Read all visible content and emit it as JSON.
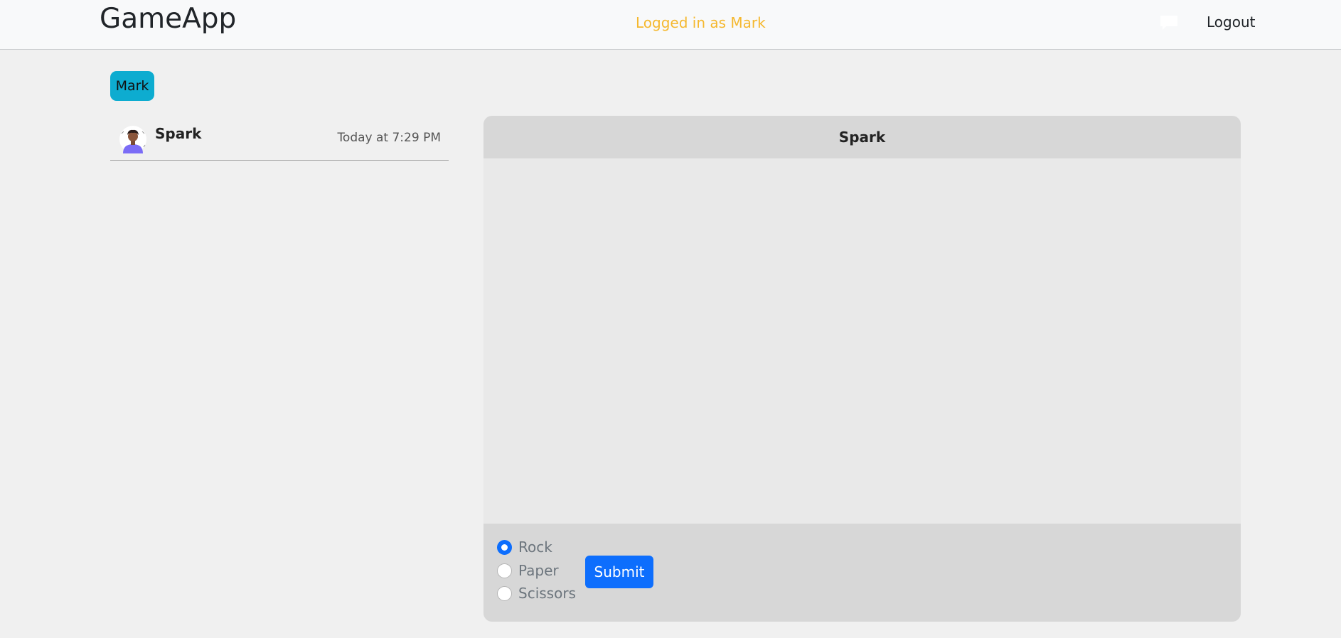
{
  "navbar": {
    "brand": "GameApp",
    "logged_in_text": "Logged in as Mark",
    "chat_icon": "chat-bubble-icon",
    "logout_label": "Logout"
  },
  "user_badge": {
    "label": "Mark",
    "color": "#0dacd0"
  },
  "conversations": [
    {
      "name": "Spark",
      "time": "Today at 7:29 PM",
      "avatar_icon": "user-avatar-icon"
    }
  ],
  "chat": {
    "title": "Spark",
    "options": [
      {
        "label": "Rock",
        "checked": true
      },
      {
        "label": "Paper",
        "checked": false
      },
      {
        "label": "Scissors",
        "checked": false
      }
    ],
    "submit_label": "Submit"
  },
  "colors": {
    "accent": "#0d6efd",
    "logged_in": "#f5b82e",
    "badge": "#0dacd0"
  }
}
